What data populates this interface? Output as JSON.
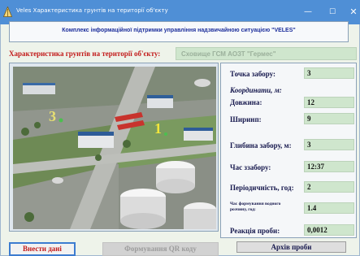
{
  "window": {
    "title": "Veles  Характеристика грунтів на території об'єкту",
    "minimize_glyph": "—",
    "maximize_glyph": "☐",
    "close_glyph": "✕"
  },
  "header": {
    "text": "Комплекс інформаційної підтримки управління надзвичайною ситуацією \"VELES\""
  },
  "section_title": "Характеристика грунтів на території  об'єкту:",
  "object_name": "Сховище ГСМ АОЗТ \"Гермес\"",
  "image": {
    "marker_1": "1",
    "marker_3": "3"
  },
  "fields": {
    "sampling_point_label": "Точка забору:",
    "sampling_point_value": "3",
    "coordinates_heading": "Координати, м:",
    "length_label": "Довжина:",
    "length_value": "12",
    "width_label": "Ширинп:",
    "width_value": "9",
    "depth_label": "Глибина забору, м:",
    "depth_value": "3",
    "time_label": "Час ззабору:",
    "time_value": "12:37",
    "periodicity_label": "Періодичність, год:",
    "periodicity_value": "2",
    "solution_time_label": "Час формування водного розчину, год:",
    "solution_time_value": "1.4",
    "reaction_label": "Реакція проби:",
    "reaction_value": "0,0012"
  },
  "buttons": {
    "archive": "Архів проби",
    "enter_data": "Внести дані",
    "qr": "Формування QR коду"
  }
}
